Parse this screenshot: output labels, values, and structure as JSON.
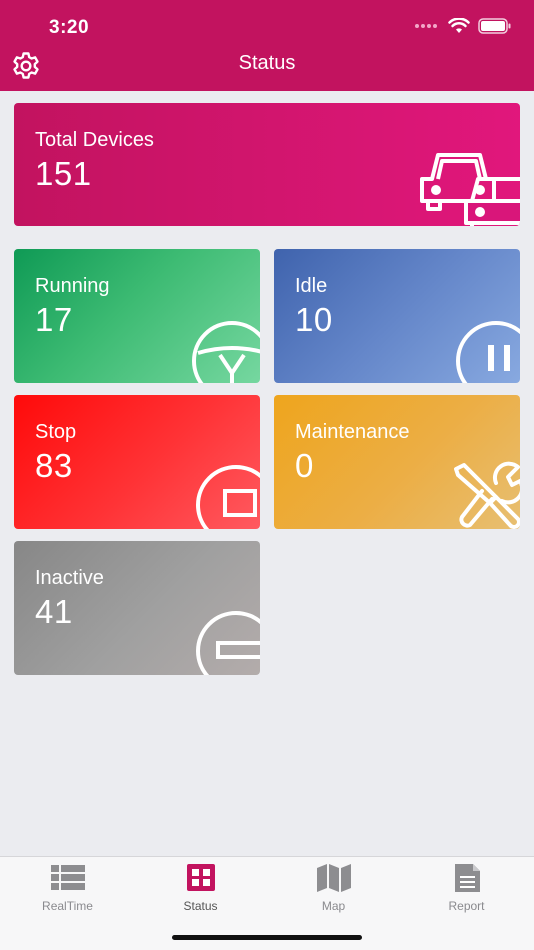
{
  "status_bar": {
    "time": "3:20"
  },
  "header": {
    "title": "Status",
    "settings_icon": "gear-icon"
  },
  "colors": {
    "brand": "#c2135f",
    "running": "#0f9a55",
    "idle": "#3f63ad",
    "stop": "#ff0a0a",
    "maintenance": "#eea51d",
    "inactive": "#878787"
  },
  "cards": {
    "total": {
      "label": "Total Devices",
      "value": "151",
      "icon": "cars-icon"
    },
    "running": {
      "label": "Running",
      "value": "17",
      "icon": "steering-wheel-icon"
    },
    "idle": {
      "label": "Idle",
      "value": "10",
      "icon": "pause-icon"
    },
    "stop": {
      "label": "Stop",
      "value": "83",
      "icon": "stop-icon"
    },
    "maintenance": {
      "label": "Maintenance",
      "value": "0",
      "icon": "tools-icon"
    },
    "inactive": {
      "label": "Inactive",
      "value": "41",
      "icon": "minus-icon"
    }
  },
  "tabs": [
    {
      "label": "RealTime",
      "icon": "list-icon",
      "active": false
    },
    {
      "label": "Status",
      "icon": "grid-icon",
      "active": true
    },
    {
      "label": "Map",
      "icon": "map-icon",
      "active": false
    },
    {
      "label": "Report",
      "icon": "document-icon",
      "active": false
    }
  ]
}
